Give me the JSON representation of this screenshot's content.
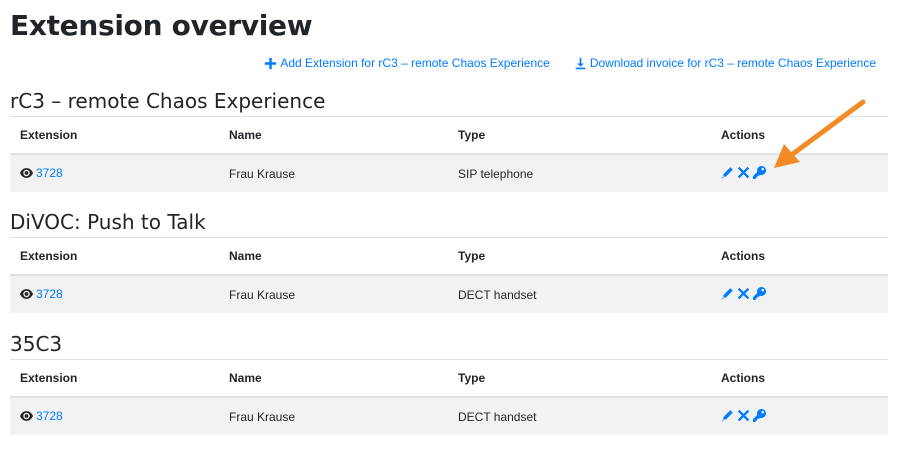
{
  "page": {
    "title": "Extension overview"
  },
  "top_links": {
    "add_label": "Add Extension for rC3 – remote Chaos Experience",
    "download_label": "Download invoice for rC3 – remote Chaos Experience"
  },
  "table_headers": {
    "extension": "Extension",
    "name": "Name",
    "type": "Type",
    "actions": "Actions"
  },
  "sections": [
    {
      "title": "rC3 – remote Chaos Experience",
      "row": {
        "extension": "3728",
        "name": "Frau Krause",
        "type": "SIP telephone"
      }
    },
    {
      "title": "DiVOC: Push to Talk",
      "row": {
        "extension": "3728",
        "name": "Frau Krause",
        "type": "DECT handset"
      }
    },
    {
      "title": "35C3",
      "row": {
        "extension": "3728",
        "name": "Frau Krause",
        "type": "DECT handset"
      }
    }
  ],
  "icons": {
    "add": "plus-icon",
    "download": "download-icon",
    "view": "eye-icon",
    "edit": "pencil-icon",
    "delete": "close-icon",
    "key": "key-icon",
    "annotation": "arrow-annotation-icon"
  },
  "colors": {
    "link": "#007bff",
    "row_bg": "#f2f2f2",
    "annotation": "#f28b25"
  }
}
